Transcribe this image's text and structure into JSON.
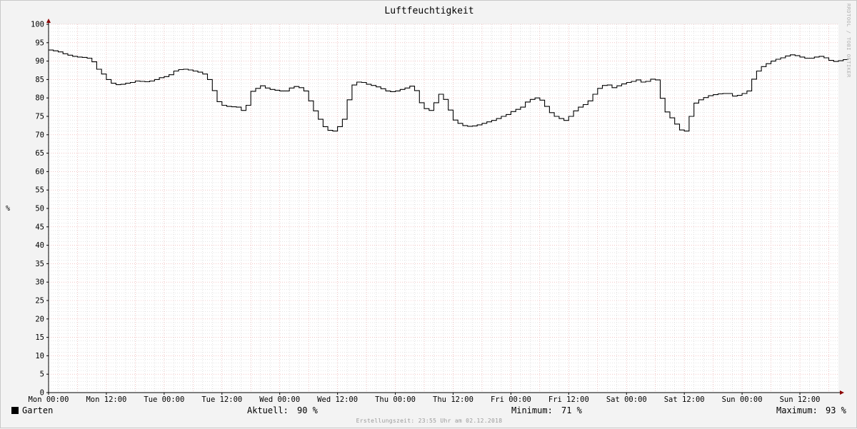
{
  "chart_data": {
    "type": "line",
    "title": "Luftfeuchtigkeit",
    "ylabel": "%",
    "ylim": [
      0,
      100
    ],
    "yticks": [
      0,
      5,
      10,
      15,
      20,
      25,
      30,
      35,
      40,
      45,
      50,
      55,
      60,
      65,
      70,
      75,
      80,
      85,
      90,
      95,
      100
    ],
    "xlim_hours": [
      0,
      164
    ],
    "xtick_hours": [
      0,
      12,
      24,
      36,
      48,
      60,
      72,
      84,
      96,
      108,
      120,
      132,
      144,
      156
    ],
    "xtick_labels": [
      "Mon 00:00",
      "Mon 12:00",
      "Tue 00:00",
      "Tue 12:00",
      "Wed 00:00",
      "Wed 12:00",
      "Thu 00:00",
      "Thu 12:00",
      "Fri 00:00",
      "Fri 12:00",
      "Sat 00:00",
      "Sat 12:00",
      "Sun 00:00",
      "Sun 12:00"
    ],
    "series": [
      {
        "name": "Garten",
        "color": "#000000",
        "x_hours": [
          0,
          1,
          2,
          3,
          4,
          5,
          6,
          7,
          8,
          9,
          10,
          11,
          12,
          13,
          14,
          15,
          16,
          17,
          18,
          19,
          20,
          21,
          22,
          23,
          24,
          25,
          26,
          27,
          28,
          29,
          30,
          31,
          32,
          33,
          34,
          35,
          36,
          37,
          38,
          39,
          40,
          41,
          42,
          43,
          44,
          45,
          46,
          47,
          48,
          49,
          50,
          51,
          52,
          53,
          54,
          55,
          56,
          57,
          58,
          59,
          60,
          61,
          62,
          63,
          64,
          65,
          66,
          67,
          68,
          69,
          70,
          71,
          72,
          73,
          74,
          75,
          76,
          77,
          78,
          79,
          80,
          81,
          82,
          83,
          84,
          85,
          86,
          87,
          88,
          89,
          90,
          91,
          92,
          93,
          94,
          95,
          96,
          97,
          98,
          99,
          100,
          101,
          102,
          103,
          104,
          105,
          106,
          107,
          108,
          109,
          110,
          111,
          112,
          113,
          114,
          115,
          116,
          117,
          118,
          119,
          120,
          121,
          122,
          123,
          124,
          125,
          126,
          127,
          128,
          129,
          130,
          131,
          132,
          133,
          134,
          135,
          136,
          137,
          138,
          139,
          140,
          141,
          142,
          143,
          144,
          145,
          146,
          147,
          148,
          149,
          150,
          151,
          152,
          153,
          154,
          155,
          156,
          157,
          158,
          159,
          160,
          161,
          162,
          163,
          164,
          165
        ],
        "values": [
          93,
          92.8,
          92.5,
          92,
          91.6,
          91.3,
          91.1,
          91,
          90.8,
          89.8,
          87.8,
          86.5,
          85,
          84,
          83.6,
          83.7,
          84,
          84.2,
          84.6,
          84.5,
          84.4,
          84.6,
          85,
          85.5,
          85.8,
          86.3,
          87.3,
          87.7,
          87.8,
          87.6,
          87.3,
          87,
          86.5,
          85,
          82,
          79,
          78,
          77.7,
          77.6,
          77.5,
          76.6,
          78,
          81.8,
          82.6,
          83.3,
          82.7,
          82.3,
          82.1,
          81.9,
          81.9,
          82.7,
          83.1,
          82.8,
          81.9,
          79.2,
          76.5,
          74.2,
          72.2,
          71.2,
          71,
          72.2,
          74.2,
          79.5,
          83.5,
          84.3,
          84.2,
          83.7,
          83.4,
          83,
          82.5,
          81.9,
          81.7,
          81.9,
          82.3,
          82.7,
          83.2,
          82,
          78.7,
          77.1,
          76.6,
          78.7,
          81,
          79.6,
          76.7,
          74,
          73.1,
          72.5,
          72.3,
          72.4,
          72.7,
          73.1,
          73.5,
          73.9,
          74.4,
          75,
          75.5,
          76.3,
          76.9,
          77.5,
          78.9,
          79.6,
          80,
          79.4,
          77.7,
          76,
          75,
          74.4,
          73.9,
          75,
          76.5,
          77.5,
          78.2,
          79.2,
          81,
          82.6,
          83.4,
          83.5,
          82.8,
          83.3,
          83.8,
          84.2,
          84.5,
          84.9,
          84.3,
          84.5,
          85.1,
          84.9,
          79.9,
          76.2,
          74.6,
          72.9,
          71.3,
          71,
          75,
          78.6,
          79.5,
          80.1,
          80.6,
          80.9,
          81.1,
          81.2,
          81.2,
          80.5,
          80.7,
          81.2,
          81.9,
          85.1,
          87.3,
          88.5,
          89.3,
          90,
          90.5,
          90.9,
          91.4,
          91.7,
          91.5,
          91.1,
          90.8,
          90.8,
          91.1,
          91.3,
          90.9,
          90.2,
          89.9,
          90.1,
          90.4,
          90.4
        ]
      }
    ],
    "legend": {
      "label": "Garten",
      "current_label": "Aktuell:",
      "current_value": "90 %",
      "min_label": "Minimum:",
      "min_value": "71 %",
      "max_label": "Maximum:",
      "max_value": "93 %"
    },
    "footer": "Erstellungszeit: 23:55 Uhr am 02.12.2018",
    "watermark": "RRDTOOL / TOBI OETIKER",
    "grid": true,
    "grid_major_color": "#e8a0a0",
    "grid_minor_color": "#c8c8c8",
    "background": "#f3f3f3",
    "plot_background": "#ffffff",
    "axis_arrow_color": "#8b0000"
  }
}
